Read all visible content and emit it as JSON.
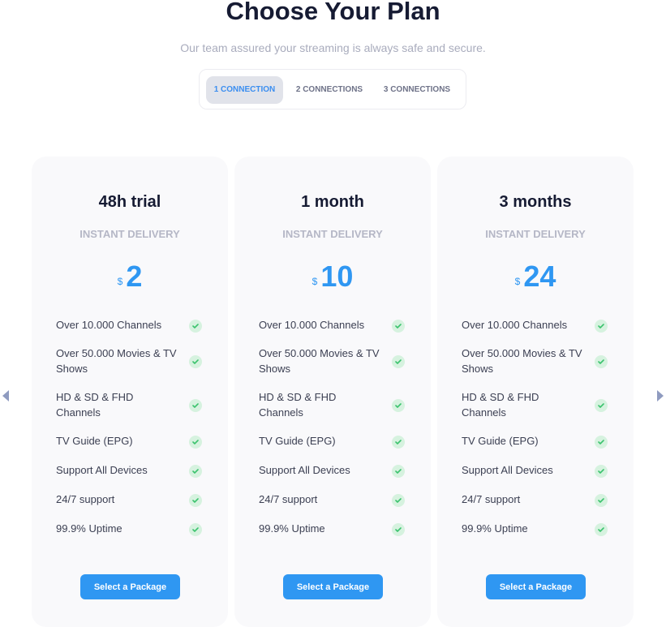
{
  "header": {
    "title": "Choose Your Plan",
    "subtitle": "Our team assured your streaming is always safe and secure."
  },
  "tabs": [
    {
      "label": "1 CONNECTION",
      "active": true
    },
    {
      "label": "2 CONNECTIONS",
      "active": false
    },
    {
      "label": "3 CONNECTIONS",
      "active": false
    }
  ],
  "plans": [
    {
      "name": "48h trial",
      "delivery": "INSTANT DELIVERY",
      "currency": "$",
      "price": "2",
      "features": [
        "Over 10.000 Channels",
        "Over 50.000 Movies & TV Shows",
        "HD & SD & FHD Channels",
        "TV Guide (EPG)",
        "Support All Devices",
        "24/7 support",
        "99.9% Uptime"
      ],
      "button": "Select a Package"
    },
    {
      "name": "1 month",
      "delivery": "INSTANT DELIVERY",
      "currency": "$",
      "price": "10",
      "features": [
        "Over 10.000 Channels",
        "Over 50.000 Movies & TV Shows",
        "HD & SD & FHD Channels",
        "TV Guide (EPG)",
        "Support All Devices",
        "24/7 support",
        "99.9% Uptime"
      ],
      "button": "Select a Package"
    },
    {
      "name": "3 months",
      "delivery": "INSTANT DELIVERY",
      "currency": "$",
      "price": "24",
      "features": [
        "Over 10.000 Channels",
        "Over 50.000 Movies & TV Shows",
        "HD & SD & FHD Channels",
        "TV Guide (EPG)",
        "Support All Devices",
        "24/7 support",
        "99.9% Uptime"
      ],
      "button": "Select a Package"
    }
  ],
  "colors": {
    "accent": "#2f97f2",
    "check_bg": "#d6f2df",
    "check_mark": "#3cc36e"
  }
}
